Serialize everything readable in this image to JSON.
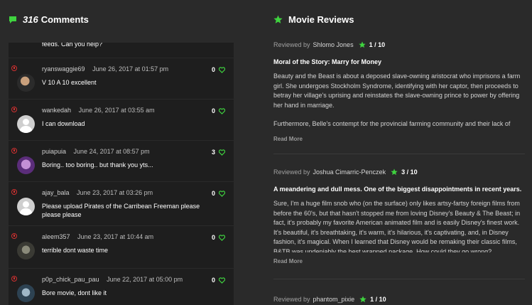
{
  "comments_header": {
    "count": "316",
    "label": "Comments"
  },
  "comments": [
    {
      "user": "",
      "date": "",
      "text": "feeds. Can you help?",
      "votes": ""
    },
    {
      "user": "ryanswaggie69",
      "date": "June 26, 2017 at 01:57 pm",
      "text": "V 10 A 10 excellent",
      "votes": "0"
    },
    {
      "user": "wankedah",
      "date": "June 26, 2017 at 03:55 am",
      "text": "I can download",
      "votes": "0"
    },
    {
      "user": "puiapuia",
      "date": "June 24, 2017 at 08:57 pm",
      "text": "Boring.. too boring.. but thank you yts...",
      "votes": "3"
    },
    {
      "user": "ajay_bala",
      "date": "June 23, 2017 at 03:26 pm",
      "text": "Please upload Pirates of the Carribean Freeman please please please",
      "votes": "0"
    },
    {
      "user": "aleem357",
      "date": "June 23, 2017 at 10:44 am",
      "text": "terrible dont waste time",
      "votes": "0"
    },
    {
      "user": "p0p_chick_pau_pau",
      "date": "June 22, 2017 at 05:00 pm",
      "text": "Bore movie, dont like it",
      "votes": "0"
    }
  ],
  "reviews_header": {
    "label": "Movie Reviews"
  },
  "reviews": [
    {
      "by_label": "Reviewed by",
      "reviewer": "Shlomo Jones",
      "score": "1 / 10",
      "title": "Moral of the Story: Marry for Money",
      "body_p1": "Beauty and the Beast is about a deposed slave-owning aristocrat who imprisons a farm girl. She undergoes Stockholm Syndrome, identifying with her captor, then proceeds to betray her village's uprising and reinstates the slave-owning prince to power by offering her hand in marriage.",
      "body_p2": "Furthermore, Belle's contempt for the provincial farming community and their lack of",
      "read_more": "Read More"
    },
    {
      "by_label": "Reviewed by",
      "reviewer": "Joshua Cimarric-Penczek",
      "score": "3 / 10",
      "title": "A meandering and dull mess. One of the biggest disappointments in recent years.",
      "body_p1": "Sure, I'm a huge film snob who (on the surface) only likes artsy-fartsy foreign films from before the 60's, but that hasn't stopped me from loving Disney's Beauty & The Beast; in fact, it's probably my favorite American animated film and is easily Disney's finest work. It's beautiful, it's breathtaking, it's warm, it's hilarious, it's captivating, and, in Disney fashion, it's magical. When I learned that Disney would be remaking their classic films, B&TB was undeniably the best wrapped package. How could they go wrong?",
      "body_p2": "",
      "read_more": "Read More"
    },
    {
      "by_label": "Reviewed by",
      "reviewer": "phantom_pixie",
      "score": "1 / 10",
      "title": "",
      "body_p1": "",
      "body_p2": "",
      "read_more": ""
    }
  ],
  "colors": {
    "accent_green": "#3fd33f",
    "flag_red": "#d03030",
    "background": "#2a2a2a",
    "comment_bg": "#1e1e1e"
  },
  "icons": {
    "comments": "speech-bubble-icon",
    "reviews": "star-icon",
    "vote": "heart-icon",
    "flag": "flag-icon"
  }
}
